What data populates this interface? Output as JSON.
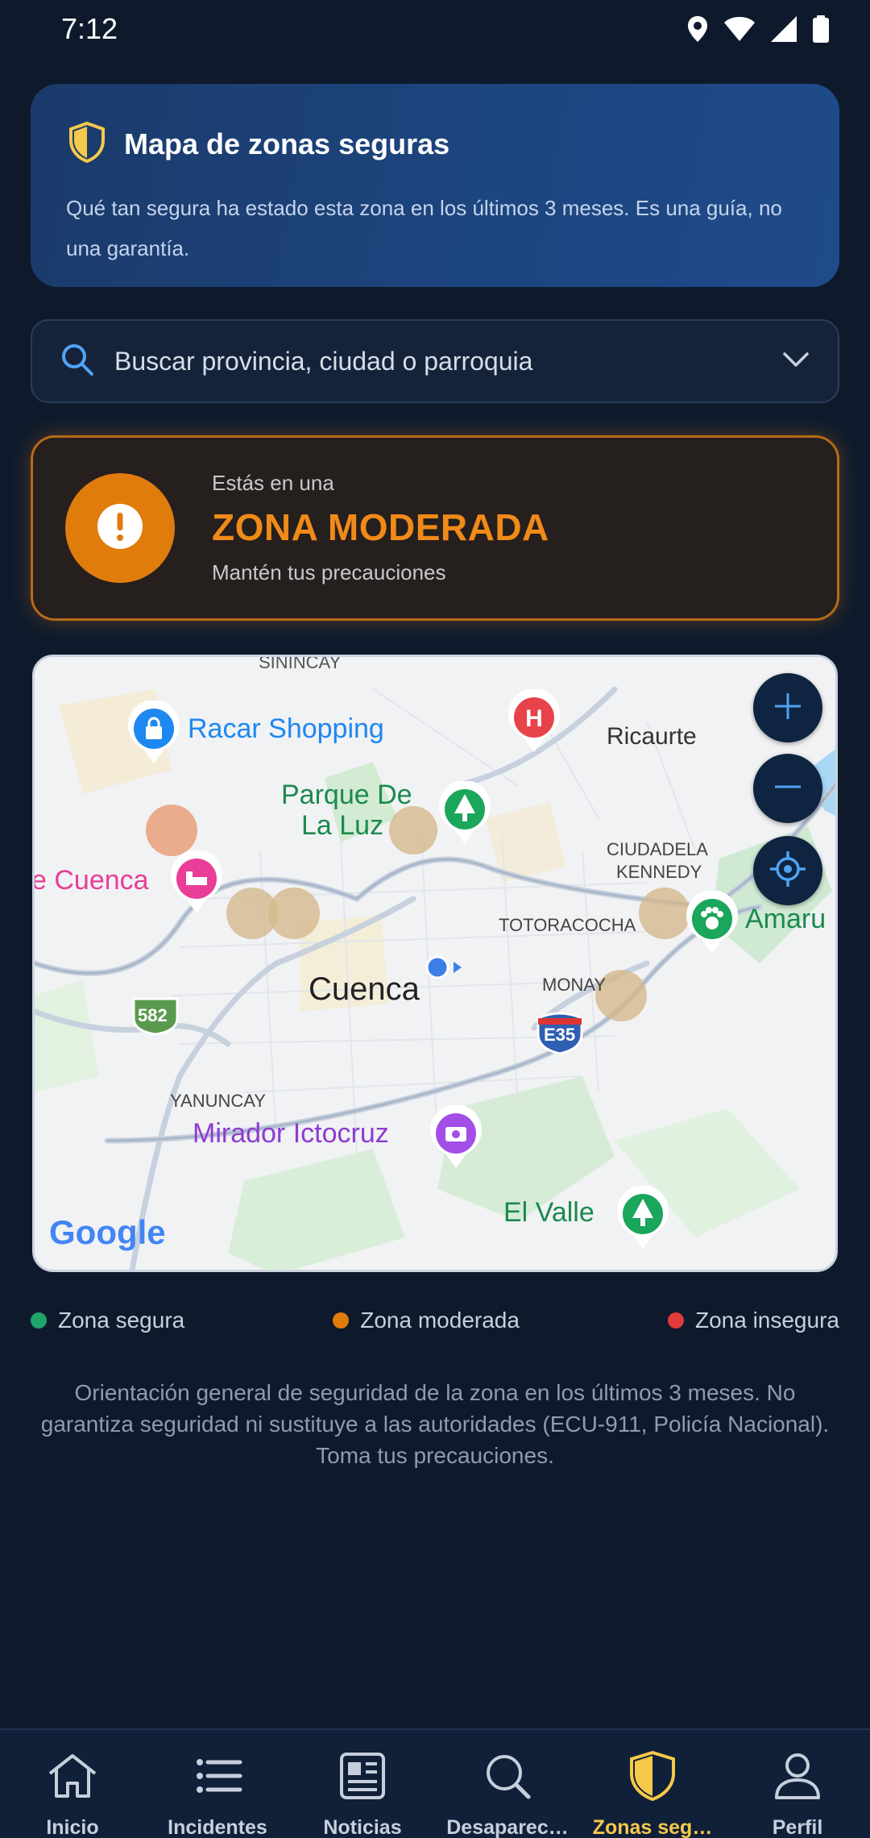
{
  "status_bar": {
    "time": "7:12"
  },
  "header": {
    "title": "Mapa de zonas seguras",
    "description": "Qué tan segura ha estado esta zona en los últimos 3 meses. Es una guía, no una garantía."
  },
  "search": {
    "placeholder": "Buscar provincia, ciudad o parroquia"
  },
  "zone_status": {
    "prefix": "Estás en una",
    "level": "ZONA MODERADA",
    "advice": "Mantén tus precauciones",
    "color": "#e07c0c"
  },
  "map": {
    "labels": {
      "sinincay": "SININCAY",
      "racar": "Racar Shopping",
      "ricaurte": "Ricaurte",
      "parque1": "Parque De",
      "parque2": "La Luz",
      "cuenca_left": "e Cuenca",
      "ciudadela1": "CIUDADELA",
      "ciudadela2": "KENNEDY",
      "totoracocha": "TOTORACOCHA",
      "amaru": "Amaru",
      "cuenca": "Cuenca",
      "monay": "MONAY",
      "route582": "582",
      "routeE35": "E35",
      "yanuncay": "YANUNCAY",
      "mirador": "Mirador Ictocruz",
      "elvalle": "El Valle",
      "google": "Google"
    },
    "zone_colors": {
      "moderate": "#d4b88c",
      "insecure": "#e9a07a"
    }
  },
  "legend": [
    {
      "label": "Zona segura",
      "color": "#1fa46a"
    },
    {
      "label": "Zona moderada",
      "color": "#e07c0c"
    },
    {
      "label": "Zona insegura",
      "color": "#e23b3b"
    }
  ],
  "disclaimer": "Orientación general de seguridad de la zona en los últimos 3 meses. No garantiza seguridad ni sustituye a las autoridades (ECU-911, Policía Nacional). Toma tus precauciones.",
  "nav": [
    {
      "label": "Inicio",
      "icon": "home-icon"
    },
    {
      "label": "Incidentes",
      "icon": "list-icon"
    },
    {
      "label": "Noticias",
      "icon": "newspaper-icon"
    },
    {
      "label": "Desaparec…",
      "icon": "search-icon"
    },
    {
      "label": "Zonas seg…",
      "icon": "shield-icon",
      "active": true
    },
    {
      "label": "Perfil",
      "icon": "person-icon"
    }
  ],
  "colors": {
    "accent": "#f5c94a",
    "background": "#0e1a2c",
    "card": "#1d4680"
  }
}
